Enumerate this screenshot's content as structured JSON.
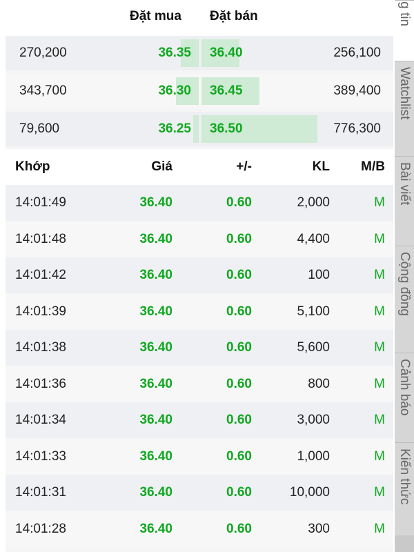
{
  "order_book": {
    "bid_header": "Đặt mua",
    "ask_header": "Đặt bán",
    "rows": [
      {
        "bid_volume": "270,200",
        "bid_price": "36.35",
        "ask_price": "36.40",
        "ask_volume": "256,100",
        "bid_fill": 0.35,
        "ask_fill": 0.33
      },
      {
        "bid_volume": "343,700",
        "bid_price": "36.30",
        "ask_price": "36.45",
        "ask_volume": "389,400",
        "bid_fill": 0.44,
        "ask_fill": 0.5
      },
      {
        "bid_volume": "79,600",
        "bid_price": "36.25",
        "ask_price": "36.50",
        "ask_volume": "776,300",
        "bid_fill": 0.1,
        "ask_fill": 1.0
      }
    ]
  },
  "trades": {
    "headers": {
      "time": "Khớp",
      "price": "Giá",
      "change": "+/-",
      "volume": "KL",
      "side": "M/B"
    },
    "rows": [
      {
        "time": "14:01:49",
        "price": "36.40",
        "change": "0.60",
        "volume": "2,000",
        "side": "M"
      },
      {
        "time": "14:01:48",
        "price": "36.40",
        "change": "0.60",
        "volume": "4,400",
        "side": "M"
      },
      {
        "time": "14:01:42",
        "price": "36.40",
        "change": "0.60",
        "volume": "100",
        "side": "M"
      },
      {
        "time": "14:01:39",
        "price": "36.40",
        "change": "0.60",
        "volume": "5,100",
        "side": "M"
      },
      {
        "time": "14:01:38",
        "price": "36.40",
        "change": "0.60",
        "volume": "5,600",
        "side": "M"
      },
      {
        "time": "14:01:36",
        "price": "36.40",
        "change": "0.60",
        "volume": "800",
        "side": "M"
      },
      {
        "time": "14:01:34",
        "price": "36.40",
        "change": "0.60",
        "volume": "3,000",
        "side": "M"
      },
      {
        "time": "14:01:33",
        "price": "36.40",
        "change": "0.60",
        "volume": "1,000",
        "side": "M"
      },
      {
        "time": "14:01:31",
        "price": "36.40",
        "change": "0.60",
        "volume": "10,000",
        "side": "M"
      },
      {
        "time": "14:01:28",
        "price": "36.40",
        "change": "0.60",
        "volume": "300",
        "side": "M"
      }
    ]
  },
  "side_tabs": [
    {
      "label": "ông tin",
      "active": true
    },
    {
      "label": "Watchlist",
      "active": false
    },
    {
      "label": "Bài viết",
      "active": false
    },
    {
      "label": "Cộng đồng",
      "active": false
    },
    {
      "label": "Cảnh báo",
      "active": false
    },
    {
      "label": "Kiến thức",
      "active": false
    }
  ],
  "colors": {
    "up": "#11a820",
    "bar": "#cfead5"
  }
}
